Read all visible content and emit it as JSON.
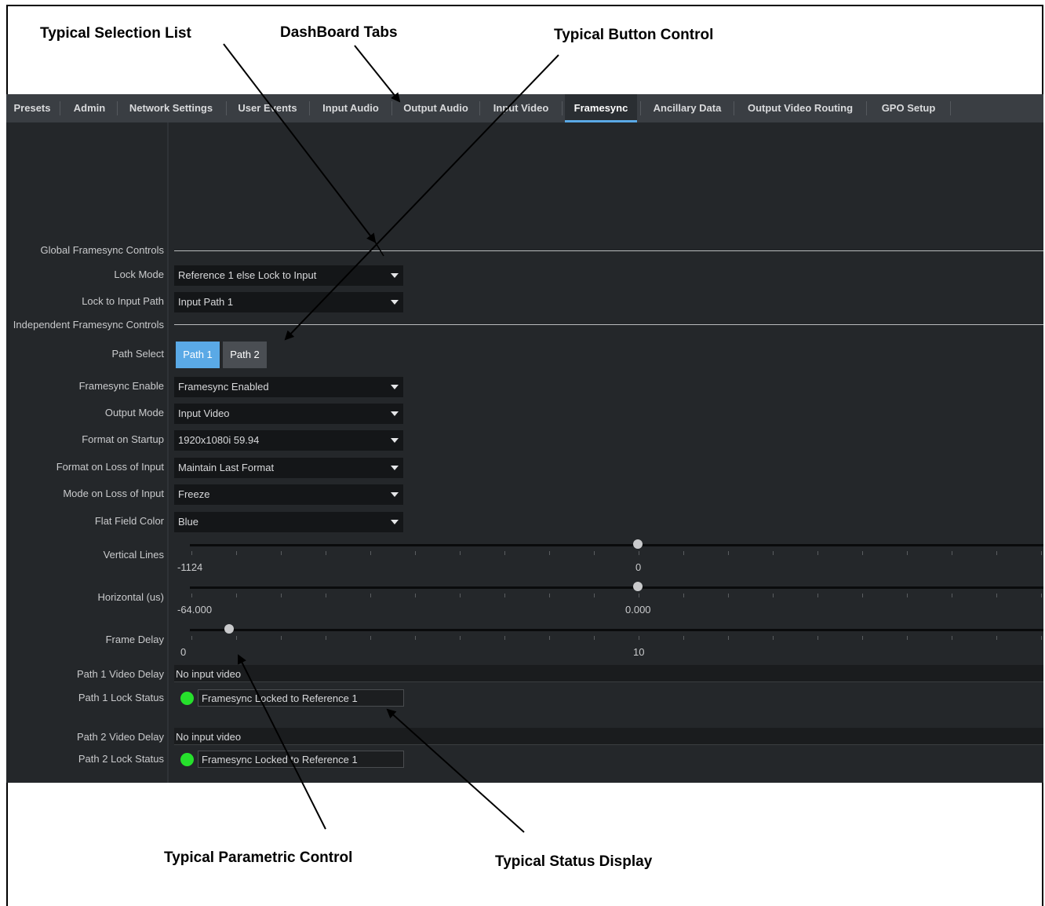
{
  "callouts": {
    "selection_list": "Typical Selection List",
    "dashboard_tabs": "DashBoard Tabs",
    "button_control": "Typical Button Control",
    "parametric_control": "Typical Parametric Control",
    "status_display": "Typical Status Display"
  },
  "tabs": [
    {
      "label": "Presets"
    },
    {
      "label": "Admin"
    },
    {
      "label": "Network Settings"
    },
    {
      "label": "User Events"
    },
    {
      "label": "Input Audio"
    },
    {
      "label": "Output Audio"
    },
    {
      "label": "Input Video"
    },
    {
      "label": "Framesync",
      "active": true
    },
    {
      "label": "Ancillary Data"
    },
    {
      "label": "Output Video Routing"
    },
    {
      "label": "GPO Setup"
    }
  ],
  "sections": {
    "global": "Global Framesync Controls",
    "independent": "Independent Framesync Controls"
  },
  "controls": {
    "lock_mode": {
      "label": "Lock Mode",
      "value": "Reference 1 else Lock to Input"
    },
    "lock_to_input_path": {
      "label": "Lock to Input Path",
      "value": "Input Path 1"
    },
    "path_select": {
      "label": "Path Select",
      "options": [
        "Path 1",
        "Path 2"
      ],
      "selected": "Path 1"
    },
    "framesync_enable": {
      "label": "Framesync Enable",
      "value": "Framesync Enabled"
    },
    "output_mode": {
      "label": "Output Mode",
      "value": "Input Video"
    },
    "format_on_startup": {
      "label": "Format on Startup",
      "value": "1920x1080i 59.94"
    },
    "format_on_loss": {
      "label": "Format on Loss of Input",
      "value": "Maintain Last Format"
    },
    "mode_on_loss": {
      "label": "Mode on Loss of Input",
      "value": "Freeze"
    },
    "flat_field_color": {
      "label": "Flat Field Color",
      "value": "Blue"
    }
  },
  "sliders": {
    "vertical_lines": {
      "label": "Vertical Lines",
      "min_label": "-1124",
      "mid_label": "0",
      "min": -1124,
      "value": 0
    },
    "horizontal": {
      "label": "Horizontal (us)",
      "min_label": "-64.000",
      "mid_label": "0.000",
      "min": -64.0,
      "value": 0.0
    },
    "frame_delay": {
      "label": "Frame Delay",
      "min_label": "0",
      "mid_label": "10",
      "min": 0,
      "value": 1
    }
  },
  "status": {
    "path1_video_delay": {
      "label": "Path 1 Video Delay",
      "value": "No input video"
    },
    "path1_lock_status": {
      "label": "Path 1 Lock Status",
      "value": "Framesync Locked to Reference 1",
      "led_color": "#26e02c"
    },
    "path2_video_delay": {
      "label": "Path 2 Video Delay",
      "value": "No input video"
    },
    "path2_lock_status": {
      "label": "Path 2 Lock Status",
      "value": "Framesync Locked to Reference 1",
      "led_color": "#26e02c"
    }
  },
  "colors": {
    "accent_blue": "#5aa9e6",
    "background": "#24272a",
    "tabbar": "#3a3e43"
  }
}
